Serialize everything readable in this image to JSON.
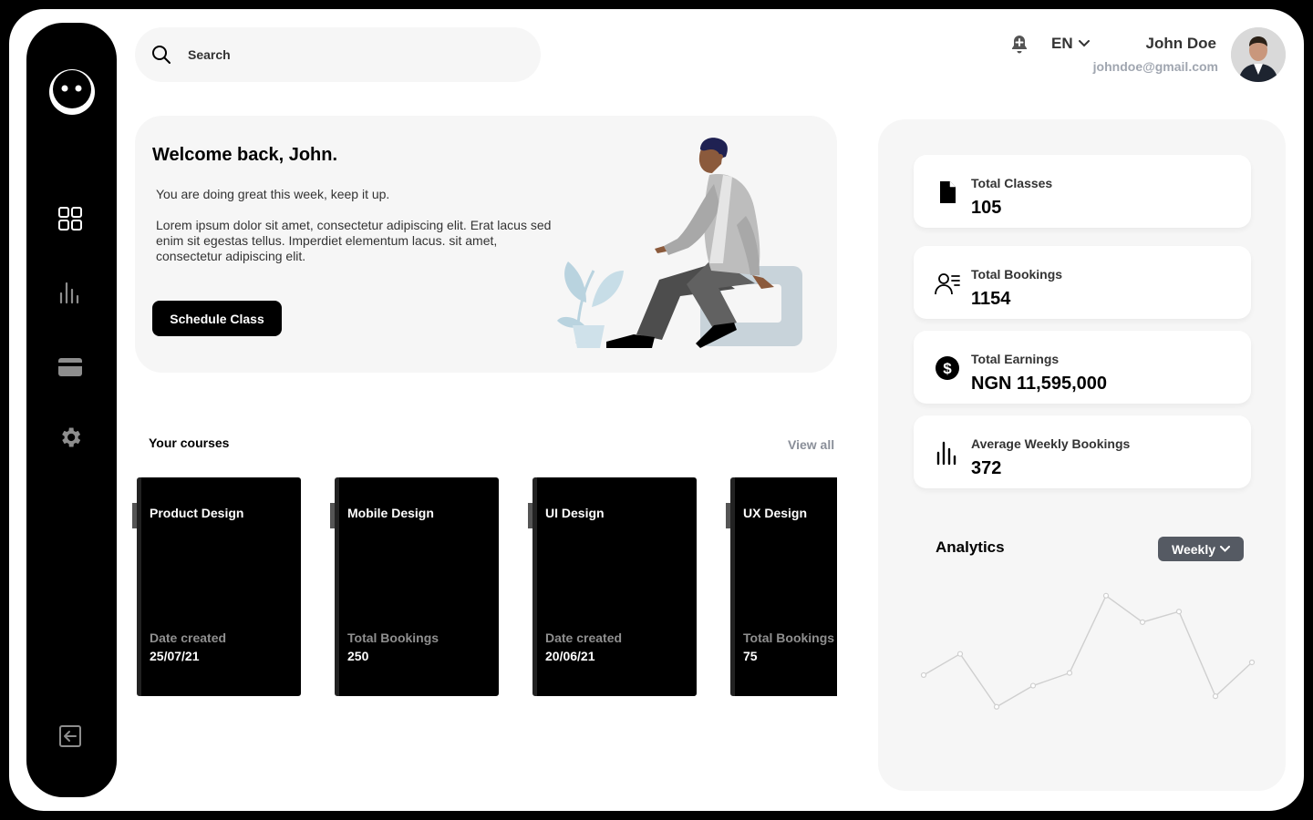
{
  "search": {
    "placeholder": "Search"
  },
  "header": {
    "language": "EN",
    "user_name": "John Doe",
    "user_email": "johndoe@gmail.com"
  },
  "sidebar": {
    "items": [
      {
        "icon": "dashboard-grid-icon"
      },
      {
        "icon": "bar-chart-icon"
      },
      {
        "icon": "credit-card-icon"
      },
      {
        "icon": "gear-icon"
      }
    ],
    "footer_icon": "logout-icon"
  },
  "welcome": {
    "title": "Welcome back, John.",
    "subtitle": "You are doing great this week, keep it up.",
    "body": "Lorem ipsum dolor sit amet, consectetur adipiscing elit. Erat lacus sed enim sit egestas tellus. Imperdiet elementum lacus. sit amet, consectetur adipiscing elit.",
    "cta_label": "Schedule Class"
  },
  "courses": {
    "title": "Your courses",
    "view_all": "View all",
    "items": [
      {
        "name": "Product Design",
        "meta_label": "Date created",
        "meta_value": "25/07/21"
      },
      {
        "name": "Mobile Design",
        "meta_label": "Total Bookings",
        "meta_value": "250"
      },
      {
        "name": "UI Design",
        "meta_label": "Date created",
        "meta_value": "20/06/21"
      },
      {
        "name": "UX Design",
        "meta_label": "Total Bookings",
        "meta_value": "75"
      }
    ]
  },
  "stats": [
    {
      "label": "Total Classes",
      "value": "105",
      "icon": "document-icon"
    },
    {
      "label": "Total Bookings",
      "value": "1154",
      "icon": "user-list-icon"
    },
    {
      "label": "Total Earnings",
      "value": "NGN 11,595,000",
      "icon": "dollar-circle-icon"
    },
    {
      "label": "Average Weekly Bookings",
      "value": "372",
      "icon": "bar-chart-icon"
    }
  ],
  "analytics": {
    "title": "Analytics",
    "period": "Weekly",
    "series": [
      50,
      70,
      20,
      40,
      52,
      125,
      100,
      110,
      30,
      62
    ]
  }
}
